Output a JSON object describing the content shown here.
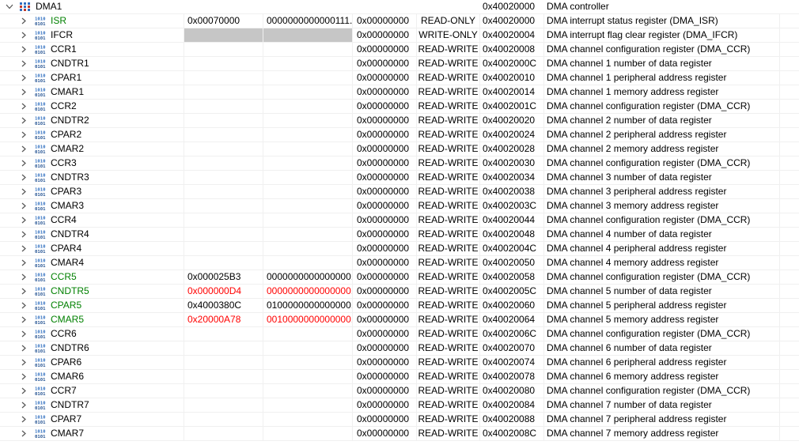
{
  "peripheral": {
    "name": "DMA1",
    "address": "0x40020000",
    "description": "DMA controller"
  },
  "colors": {
    "changed": "#008000",
    "modified_value": "#ff0000",
    "write_only_fill": "#c6c6c6",
    "grid": "#f0f0f0"
  },
  "registers": [
    {
      "name": "ISR",
      "value": "0x00070000",
      "binary": "0000000000000111...",
      "reset": "0x00000000",
      "access": "READ-ONLY",
      "address": "0x40020000",
      "description": "DMA interrupt status register (DMA_ISR)",
      "name_style": "green",
      "value_style": "normal"
    },
    {
      "name": "IFCR",
      "value": "",
      "binary": "",
      "reset": "0x00000000",
      "access": "WRITE-ONLY",
      "address": "0x40020004",
      "description": "DMA interrupt flag clear register (DMA_IFCR)",
      "name_style": "normal",
      "value_style": "normal",
      "write_only": true
    },
    {
      "name": "CCR1",
      "value": "",
      "binary": "",
      "reset": "0x00000000",
      "access": "READ-WRITE",
      "address": "0x40020008",
      "description": "DMA channel configuration register (DMA_CCR)",
      "name_style": "normal",
      "value_style": "normal"
    },
    {
      "name": "CNDTR1",
      "value": "",
      "binary": "",
      "reset": "0x00000000",
      "access": "READ-WRITE",
      "address": "0x4002000C",
      "description": "DMA channel 1 number of data register",
      "name_style": "normal",
      "value_style": "normal"
    },
    {
      "name": "CPAR1",
      "value": "",
      "binary": "",
      "reset": "0x00000000",
      "access": "READ-WRITE",
      "address": "0x40020010",
      "description": "DMA channel 1 peripheral address register",
      "name_style": "normal",
      "value_style": "normal"
    },
    {
      "name": "CMAR1",
      "value": "",
      "binary": "",
      "reset": "0x00000000",
      "access": "READ-WRITE",
      "address": "0x40020014",
      "description": "DMA channel 1 memory address register",
      "name_style": "normal",
      "value_style": "normal"
    },
    {
      "name": "CCR2",
      "value": "",
      "binary": "",
      "reset": "0x00000000",
      "access": "READ-WRITE",
      "address": "0x4002001C",
      "description": "DMA channel configuration register (DMA_CCR)",
      "name_style": "normal",
      "value_style": "normal"
    },
    {
      "name": "CNDTR2",
      "value": "",
      "binary": "",
      "reset": "0x00000000",
      "access": "READ-WRITE",
      "address": "0x40020020",
      "description": "DMA channel 2 number of data register",
      "name_style": "normal",
      "value_style": "normal"
    },
    {
      "name": "CPAR2",
      "value": "",
      "binary": "",
      "reset": "0x00000000",
      "access": "READ-WRITE",
      "address": "0x40020024",
      "description": "DMA channel 2 peripheral address register",
      "name_style": "normal",
      "value_style": "normal"
    },
    {
      "name": "CMAR2",
      "value": "",
      "binary": "",
      "reset": "0x00000000",
      "access": "READ-WRITE",
      "address": "0x40020028",
      "description": "DMA channel 2 memory address register",
      "name_style": "normal",
      "value_style": "normal"
    },
    {
      "name": "CCR3",
      "value": "",
      "binary": "",
      "reset": "0x00000000",
      "access": "READ-WRITE",
      "address": "0x40020030",
      "description": "DMA channel configuration register (DMA_CCR)",
      "name_style": "normal",
      "value_style": "normal"
    },
    {
      "name": "CNDTR3",
      "value": "",
      "binary": "",
      "reset": "0x00000000",
      "access": "READ-WRITE",
      "address": "0x40020034",
      "description": "DMA channel 3 number of data register",
      "name_style": "normal",
      "value_style": "normal"
    },
    {
      "name": "CPAR3",
      "value": "",
      "binary": "",
      "reset": "0x00000000",
      "access": "READ-WRITE",
      "address": "0x40020038",
      "description": "DMA channel 3 peripheral address register",
      "name_style": "normal",
      "value_style": "normal"
    },
    {
      "name": "CMAR3",
      "value": "",
      "binary": "",
      "reset": "0x00000000",
      "access": "READ-WRITE",
      "address": "0x4002003C",
      "description": "DMA channel 3 memory address register",
      "name_style": "normal",
      "value_style": "normal"
    },
    {
      "name": "CCR4",
      "value": "",
      "binary": "",
      "reset": "0x00000000",
      "access": "READ-WRITE",
      "address": "0x40020044",
      "description": "DMA channel configuration register (DMA_CCR)",
      "name_style": "normal",
      "value_style": "normal"
    },
    {
      "name": "CNDTR4",
      "value": "",
      "binary": "",
      "reset": "0x00000000",
      "access": "READ-WRITE",
      "address": "0x40020048",
      "description": "DMA channel 4 number of data register",
      "name_style": "normal",
      "value_style": "normal"
    },
    {
      "name": "CPAR4",
      "value": "",
      "binary": "",
      "reset": "0x00000000",
      "access": "READ-WRITE",
      "address": "0x4002004C",
      "description": "DMA channel 4 peripheral address register",
      "name_style": "normal",
      "value_style": "normal"
    },
    {
      "name": "CMAR4",
      "value": "",
      "binary": "",
      "reset": "0x00000000",
      "access": "READ-WRITE",
      "address": "0x40020050",
      "description": "DMA channel 4 memory address register",
      "name_style": "normal",
      "value_style": "normal"
    },
    {
      "name": "CCR5",
      "value": "0x000025B3",
      "binary": "0000000000000000...",
      "reset": "0x00000000",
      "access": "READ-WRITE",
      "address": "0x40020058",
      "description": "DMA channel configuration register (DMA_CCR)",
      "name_style": "green",
      "value_style": "normal"
    },
    {
      "name": "CNDTR5",
      "value": "0x000000D4",
      "binary": "0000000000000000...",
      "reset": "0x00000000",
      "access": "READ-WRITE",
      "address": "0x4002005C",
      "description": "DMA channel 5 number of data register",
      "name_style": "green",
      "value_style": "red"
    },
    {
      "name": "CPAR5",
      "value": "0x4000380C",
      "binary": "0100000000000000...",
      "reset": "0x00000000",
      "access": "READ-WRITE",
      "address": "0x40020060",
      "description": "DMA channel 5 peripheral address register",
      "name_style": "green",
      "value_style": "normal"
    },
    {
      "name": "CMAR5",
      "value": "0x20000A78",
      "binary": "0010000000000000...",
      "reset": "0x00000000",
      "access": "READ-WRITE",
      "address": "0x40020064",
      "description": "DMA channel 5 memory address register",
      "name_style": "green",
      "value_style": "red"
    },
    {
      "name": "CCR6",
      "value": "",
      "binary": "",
      "reset": "0x00000000",
      "access": "READ-WRITE",
      "address": "0x4002006C",
      "description": "DMA channel configuration register (DMA_CCR)",
      "name_style": "normal",
      "value_style": "normal"
    },
    {
      "name": "CNDTR6",
      "value": "",
      "binary": "",
      "reset": "0x00000000",
      "access": "READ-WRITE",
      "address": "0x40020070",
      "description": "DMA channel 6 number of data register",
      "name_style": "normal",
      "value_style": "normal"
    },
    {
      "name": "CPAR6",
      "value": "",
      "binary": "",
      "reset": "0x00000000",
      "access": "READ-WRITE",
      "address": "0x40020074",
      "description": "DMA channel 6 peripheral address register",
      "name_style": "normal",
      "value_style": "normal"
    },
    {
      "name": "CMAR6",
      "value": "",
      "binary": "",
      "reset": "0x00000000",
      "access": "READ-WRITE",
      "address": "0x40020078",
      "description": "DMA channel 6 memory address register",
      "name_style": "normal",
      "value_style": "normal"
    },
    {
      "name": "CCR7",
      "value": "",
      "binary": "",
      "reset": "0x00000000",
      "access": "READ-WRITE",
      "address": "0x40020080",
      "description": "DMA channel configuration register (DMA_CCR)",
      "name_style": "normal",
      "value_style": "normal"
    },
    {
      "name": "CNDTR7",
      "value": "",
      "binary": "",
      "reset": "0x00000000",
      "access": "READ-WRITE",
      "address": "0x40020084",
      "description": "DMA channel 7 number of data register",
      "name_style": "normal",
      "value_style": "normal"
    },
    {
      "name": "CPAR7",
      "value": "",
      "binary": "",
      "reset": "0x00000000",
      "access": "READ-WRITE",
      "address": "0x40020088",
      "description": "DMA channel 7 peripheral address register",
      "name_style": "normal",
      "value_style": "normal"
    },
    {
      "name": "CMAR7",
      "value": "",
      "binary": "",
      "reset": "0x00000000",
      "access": "READ-WRITE",
      "address": "0x4002008C",
      "description": "DMA channel 7 memory address register",
      "name_style": "normal",
      "value_style": "normal"
    }
  ]
}
